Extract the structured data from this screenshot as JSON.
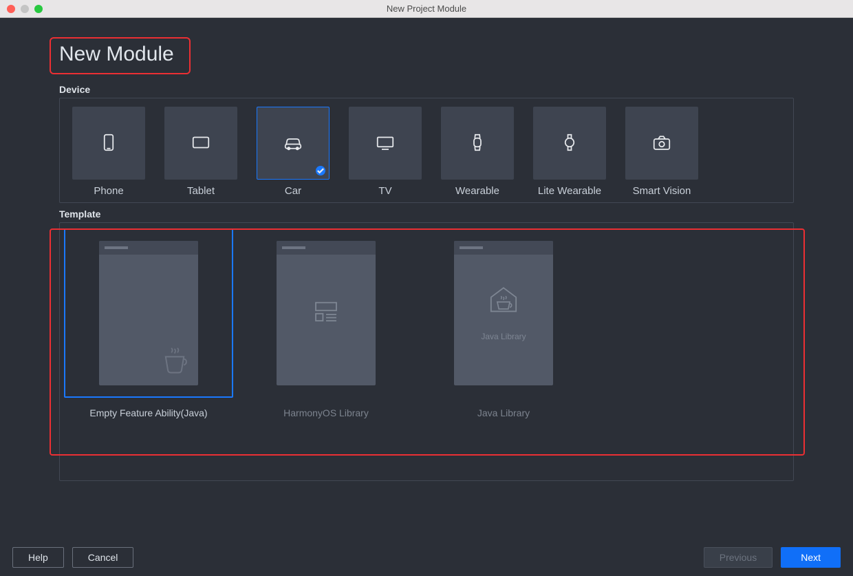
{
  "window": {
    "title": "New Project Module"
  },
  "header": {
    "title": "New Module"
  },
  "sections": {
    "device_label": "Device",
    "template_label": "Template"
  },
  "devices": [
    {
      "label": "Phone",
      "selected": false
    },
    {
      "label": "Tablet",
      "selected": false
    },
    {
      "label": "Car",
      "selected": true
    },
    {
      "label": "TV",
      "selected": false
    },
    {
      "label": "Wearable",
      "selected": false
    },
    {
      "label": "Lite Wearable",
      "selected": false
    },
    {
      "label": "Smart Vision",
      "selected": false
    }
  ],
  "templates": [
    {
      "label": "Empty Feature Ability(Java)",
      "selected": true
    },
    {
      "label": "HarmonyOS Library",
      "selected": false
    },
    {
      "label": "Java Library",
      "selected": false,
      "card_caption": "Java Library"
    }
  ],
  "footer": {
    "help": "Help",
    "cancel": "Cancel",
    "previous": "Previous",
    "next": "Next"
  }
}
